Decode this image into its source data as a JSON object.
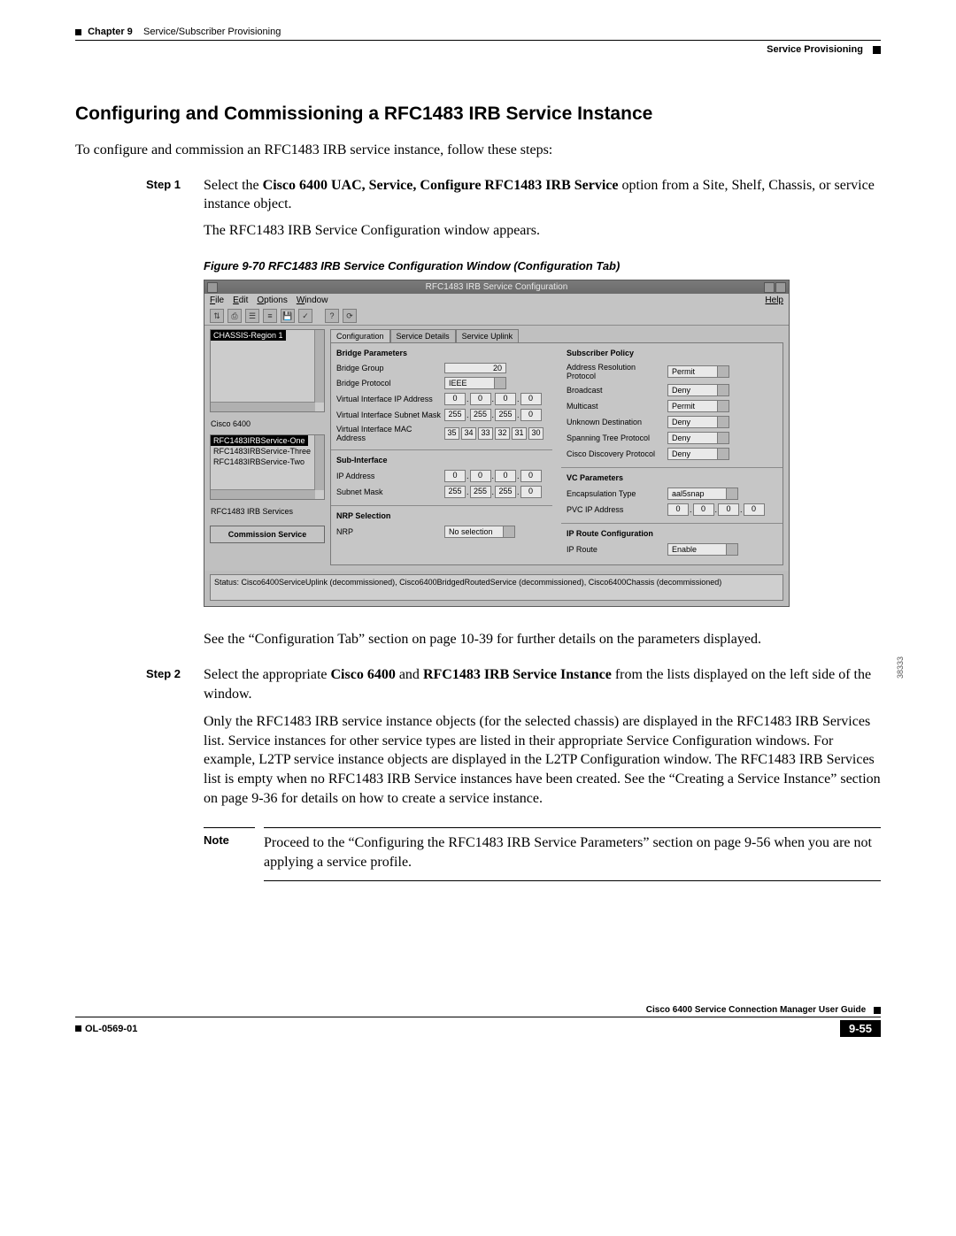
{
  "header": {
    "chapter": "Chapter 9",
    "chapter_title": "Service/Subscriber Provisioning",
    "section": "Service Provisioning"
  },
  "title": "Configuring and Commissioning a RFC1483 IRB Service Instance",
  "intro": "To configure and commission an RFC1483 IRB service instance, follow these steps:",
  "steps": {
    "s1_label": "Step 1",
    "s1_a": "Select the ",
    "s1_b": "Cisco 6400 UAC, Service, Configure RFC1483 IRB Service",
    "s1_c": " option from a Site, Shelf, Chassis, or service instance object.",
    "s1_d": "The RFC1483 IRB Service Configuration window appears.",
    "s2_label": "Step 2",
    "s2_a": "Select the appropriate ",
    "s2_b": "Cisco 6400",
    "s2_c": " and ",
    "s2_d": "RFC1483 IRB Service Instance",
    "s2_e": " from the lists displayed on the left side of the window."
  },
  "figure": {
    "caption": "Figure 9-70   RFC1483 IRB Service Configuration Window (Configuration Tab)",
    "imgno": "38333"
  },
  "app": {
    "title": "RFC1483 IRB Service Configuration",
    "menus": {
      "file": "File",
      "edit": "Edit",
      "options": "Options",
      "window": "Window",
      "help": "Help"
    },
    "left": {
      "chassis_sel": "CHASSIS-Region 1",
      "panel1": "Cisco 6400",
      "svc0": "RFC1483IRBService-One",
      "svc1": "RFC1483IRBService-Three",
      "svc2": "RFC1483IRBService-Two",
      "panel2": "RFC1483 IRB Services",
      "commission": "Commission Service"
    },
    "tabs": {
      "t0": "Configuration",
      "t1": "Service Details",
      "t2": "Service Uplink"
    },
    "bp": {
      "title": "Bridge Parameters",
      "bg_l": "Bridge Group",
      "bg_v": "20",
      "proto_l": "Bridge Protocol",
      "proto_v": "IEEE",
      "vip_l": "Virtual Interface IP Address",
      "vmask_l": "Virtual Interface Subnet Mask",
      "vmac_l": "Virtual Interface MAC Address",
      "ip0": "0",
      "ip1": "0",
      "ip2": "0",
      "ip3": "0",
      "m0": "255",
      "m1": "255",
      "m2": "255",
      "m3": "0",
      "mac0": "35",
      "mac1": "34",
      "mac2": "33",
      "mac3": "32",
      "mac4": "31",
      "mac5": "30"
    },
    "sub": {
      "title": "Sub-Interface",
      "ip_l": "IP Address",
      "mask_l": "Subnet Mask",
      "ip0": "0",
      "ip1": "0",
      "ip2": "0",
      "ip3": "0",
      "m0": "255",
      "m1": "255",
      "m2": "255",
      "m3": "0"
    },
    "nrp": {
      "title": "NRP Selection",
      "l": "NRP",
      "v": "No selection"
    },
    "pol": {
      "title": "Subscriber Policy",
      "arp_l": "Address Resolution Protocol",
      "arp_v": "Permit",
      "bc_l": "Broadcast",
      "bc_v": "Deny",
      "mc_l": "Multicast",
      "mc_v": "Permit",
      "ud_l": "Unknown Destination",
      "ud_v": "Deny",
      "stp_l": "Spanning Tree Protocol",
      "stp_v": "Deny",
      "cdp_l": "Cisco Discovery Protocol",
      "cdp_v": "Deny"
    },
    "vc": {
      "title": "VC Parameters",
      "enc_l": "Encapsulation Type",
      "enc_v": "aal5snap",
      "pvc_l": "PVC IP Address",
      "p0": "0",
      "p1": "0",
      "p2": "0",
      "p3": "0"
    },
    "ipr": {
      "title": "IP Route Configuration",
      "l": "IP Route",
      "v": "Enable"
    },
    "status": "Status: Cisco6400ServiceUplink (decommissioned), Cisco6400BridgedRoutedService (decommissioned), Cisco6400Chassis (decommissioned)"
  },
  "post": {
    "p1": "See the “Configuration Tab” section on page 10-39 for further details on the parameters displayed.",
    "p2": "Only the RFC1483 IRB service instance objects (for the selected chassis) are displayed in the RFC1483 IRB Services list. Service instances for other service types are listed in their appropriate Service Configuration windows. For example, L2TP service instance objects are displayed in the L2TP Configuration window. The RFC1483 IRB Services list is empty when no RFC1483 IRB Service instances have been created. See the “Creating a Service Instance” section on page 9-36 for details on how to create a service instance."
  },
  "note": {
    "label": "Note",
    "text": "Proceed to the “Configuring the RFC1483 IRB Service Parameters” section on page 9-56 when you are not applying a service profile."
  },
  "footer": {
    "doc": "Cisco 6400 Service Connection Manager User Guide",
    "ol": "OL-0569-01",
    "page": "9-55"
  }
}
